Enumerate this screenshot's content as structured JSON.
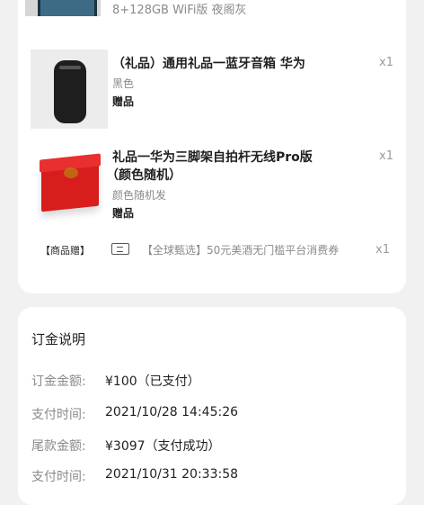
{
  "products": [
    {
      "spec": "8+128GB WiFi版 夜阁灰",
      "thumb_icon": "tablet-image"
    },
    {
      "title": "（礼品）通用礼品一蓝牙音箱 华为",
      "spec": "黑色",
      "tag": "赠品",
      "qty": "x1",
      "thumb_icon": "bluetooth-speaker-image"
    },
    {
      "title_line1": "礼品一华为三脚架自拍杆无线Pro版",
      "title_line2": "（颜色随机）",
      "spec": "颜色随机发",
      "tag": "赠品",
      "qty": "x1",
      "thumb_icon": "red-gift-box-image"
    }
  ],
  "gift_row": {
    "label": "【商品赠】",
    "icon": "coupon-icon",
    "text": "【全球甄选】50元美酒无门槛平台消费券",
    "qty": "x1"
  },
  "deposit": {
    "title": "订金说明",
    "rows": [
      {
        "label": "订金金额:",
        "value": "¥100（已支付）"
      },
      {
        "label": "支付时间:",
        "value": "2021/10/28 14:45:26"
      },
      {
        "label": "尾款金额:",
        "value": "¥3097（支付成功）"
      },
      {
        "label": "支付时间:",
        "value": "2021/10/31 20:33:58"
      }
    ]
  }
}
